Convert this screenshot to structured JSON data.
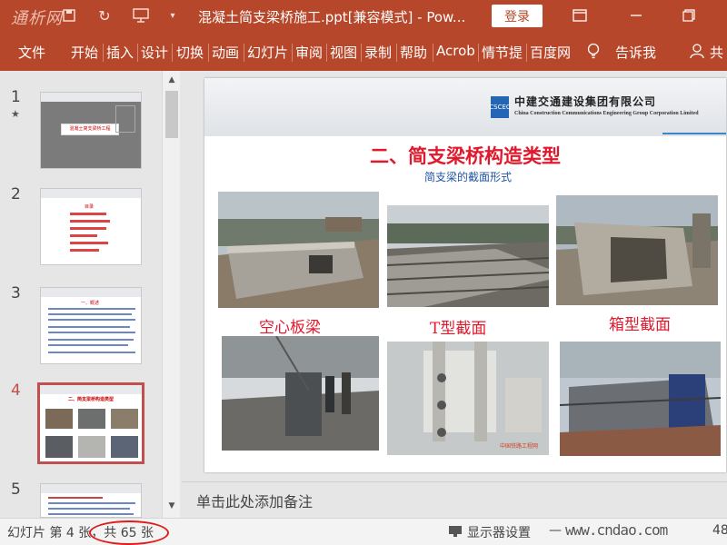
{
  "app": {
    "logo_text": "通析网",
    "document_title": "混凝土简支梁桥施工.ppt[兼容模式] - Pow...",
    "login_label": "登录"
  },
  "ribbon": {
    "tabs": [
      "文件",
      "开始",
      "插入",
      "设计",
      "切换",
      "动画",
      "幻灯片",
      "审阅",
      "视图",
      "录制",
      "帮助",
      "Acrob",
      "情节提",
      "百度网"
    ],
    "tell_me": "告诉我",
    "share": "共"
  },
  "thumbnails": [
    {
      "number": "1",
      "title": "混凝土简支梁桥工程",
      "starred": true
    },
    {
      "number": "2",
      "title": "目录"
    },
    {
      "number": "3",
      "title": "一、概述"
    },
    {
      "number": "4",
      "title": "二、简支梁桥构造类型",
      "active": true
    },
    {
      "number": "5",
      "title": ""
    }
  ],
  "slide": {
    "company_logo_text": "CSCEC",
    "company_name_cn": "中建交通建设集团有限公司",
    "company_name_en": "China Construction Communications Engineering Group Corporation Limited",
    "title": "二、简支梁桥构造类型",
    "subtitle": "简支梁的截面形式",
    "captions": [
      "空心板梁",
      "T型截面",
      "箱型截面"
    ],
    "photo_credit": "中国铁路工程网"
  },
  "notes_placeholder": "单击此处添加备注",
  "status": {
    "slide_position": "幻灯片 第 4 张，共 65 张",
    "display_settings": "显示器设置",
    "watermark": "www.cndao.com",
    "zoom_fragment": "48"
  },
  "colors": {
    "ribbon": "#b7472a",
    "title_red": "#e0192d",
    "subtitle_blue": "#2255a4",
    "highlight": "#e01b1b"
  }
}
